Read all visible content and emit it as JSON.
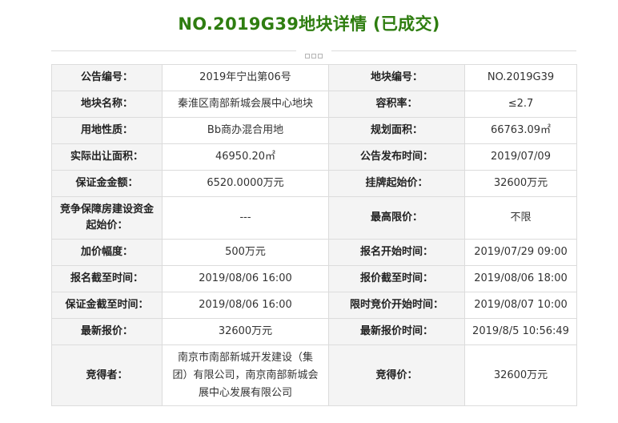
{
  "page_title": "NO.2019G39地块详情 (已成交)",
  "colors": {
    "title": "#2e7d10",
    "price_start": "#2e7d10",
    "winning_price": "#e02020"
  },
  "rows": [
    {
      "k1": "公告编号：",
      "v1": "2019年宁出第06号",
      "k2": "地块编号：",
      "v2": "NO.2019G39"
    },
    {
      "k1": "地块名称：",
      "v1": "秦淮区南部新城会展中心地块",
      "k2": "容积率：",
      "v2": "≤2.7"
    },
    {
      "k1": "用地性质：",
      "v1": "Bb商办混合用地",
      "k2": "规划面积：",
      "v2": "66763.09㎡"
    },
    {
      "k1": "实际出让面积：",
      "v1": "46950.20㎡",
      "k2": "公告发布时间：",
      "v2": "2019/07/09"
    },
    {
      "k1": "保证金金额：",
      "v1": "6520.0000万元",
      "k2": "挂牌起始价：",
      "v2": "32600万元"
    },
    {
      "k1": "竞争保障房建设资金起始价：",
      "v1": "---",
      "k2": "最高限价：",
      "v2": "不限"
    },
    {
      "k1": "加价幅度：",
      "v1": "500万元",
      "k2": "报名开始时间：",
      "v2": "2019/07/29 09:00"
    },
    {
      "k1": "报名截至时间：",
      "v1": "2019/08/06 16:00",
      "k2": "报价截至时间：",
      "v2": "2019/08/06 18:00"
    },
    {
      "k1": "保证金截至时间：",
      "v1": "2019/08/06 16:00",
      "k2": "限时竞价开始时间：",
      "v2": "2019/08/07 10:00"
    },
    {
      "k1": "最新报价：",
      "v1": "32600万元",
      "k2": "最新报价时间：",
      "v2": "2019/8/5 10:56:49"
    },
    {
      "k1": "竞得者：",
      "v1": "南京市南部新城开发建设（集团）有限公司，南京南部新城会展中心发展有限公司",
      "k2": "竞得价：",
      "v2": "32600万元"
    }
  ]
}
